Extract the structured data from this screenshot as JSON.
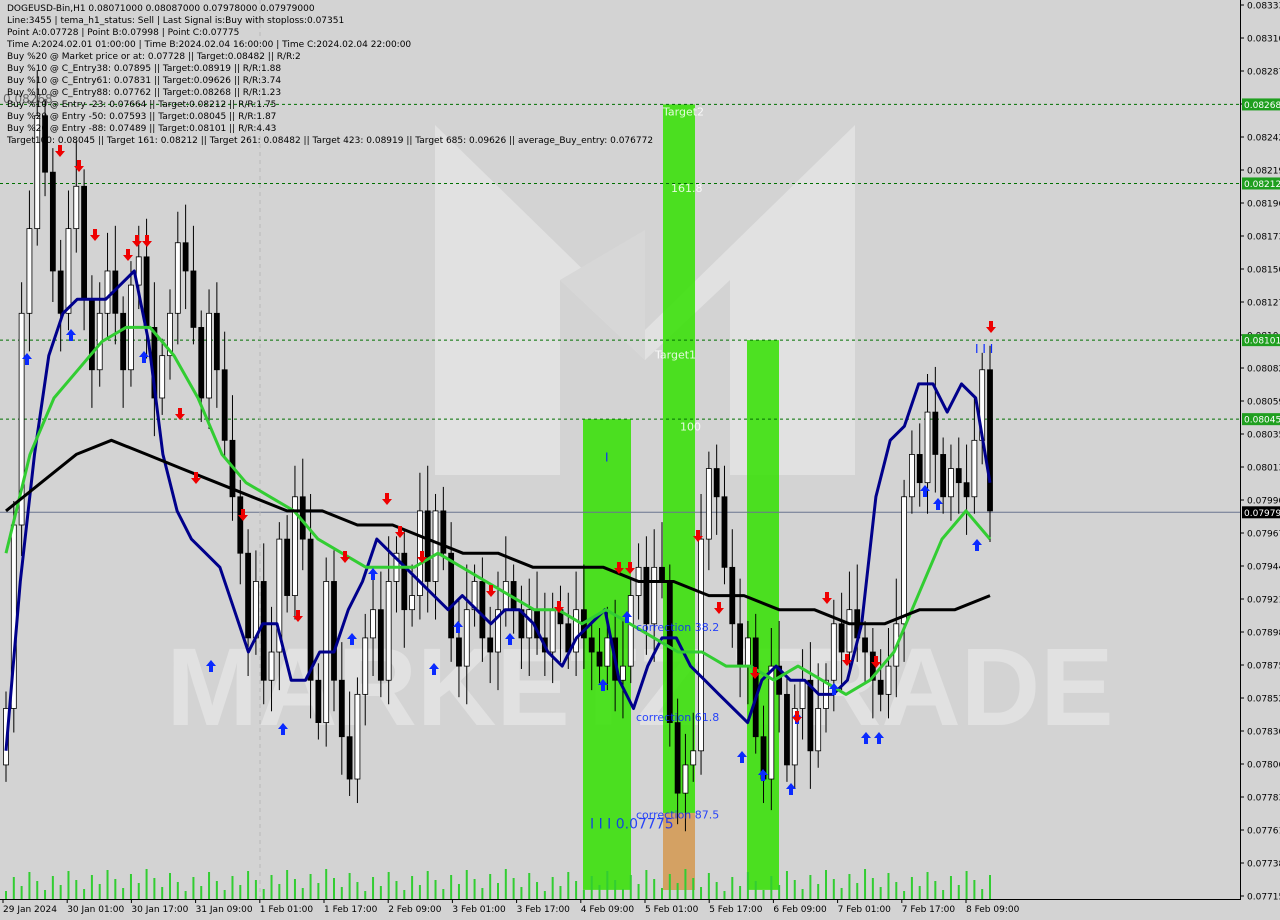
{
  "header": {
    "lines": [
      "DOGEUSD-Bin,H1  0.08071000 0.08087000 0.07978000 0.07979000",
      "Line:3455  |  tema_h1_status: Sell  |  Last Signal is:Buy with stoploss:0.07351",
      "Point A:0.07728  |  Point B:0.07998  |  Point C:0.07775",
      "Time A:2024.02.01 01:00:00  |  Time B:2024.02.04 16:00:00  |  Time C:2024.02.04 22:00:00",
      "Buy %20 @ Market price or at: 0.07728  ||  Target:0.08482  ||  R/R:2",
      "Buy %10 @ C_Entry38: 0.07895  ||  Target:0.08919  ||  R/R:1.88",
      "Buy %10 @ C_Entry61: 0.07831  ||  Target:0.09626  ||  R/R:3.74",
      "Buy %10 @ C_Entry88: 0.07762  ||  Target:0.08268  ||  R/R:1.23",
      "Buy %10 @ Entry -23: 0.07664  ||  Target:0.08212  ||  R/R:1.75",
      "Buy %20 @ Entry -50: 0.07593  ||  Target:0.08045  ||  R/R:1.87",
      "Buy %20 @ Entry -88: 0.07489  ||  Target:0.08101  ||  R/R:4.43",
      "Target100: 0.08045  ||  Target 161: 0.08212  ||  Target 261: 0.08482  ||  Target 423: 0.08919  ||  Target 685: 0.09626  ||  average_Buy_entry: 0.076772"
    ],
    "overlay_price": "0.08268"
  },
  "watermark": {
    "text": "MARKETZ TRADE"
  },
  "colors": {
    "background": "#d3d3d3",
    "bull_candle": "#ffffff",
    "bear_candle": "#000000",
    "fast_ma": "#00008b",
    "mid_ma": "#32cd32",
    "slow_ma": "#000000",
    "target_green": "#32e100",
    "fib_orange": "#e39a6a",
    "buy_arrow": "#0a2aff",
    "sell_arrow": "#ee0000",
    "level_line": "#007000",
    "price_tag": "#000000"
  },
  "zones": [
    {
      "label": "Target2",
      "x_from": "5 Feb 01:00",
      "x_to": "5 Feb 09:00",
      "y_top": 0.08268,
      "y_bottom": 0.07715,
      "color": "#32e100"
    },
    {
      "label": "Target1",
      "x_from": "6 Feb 01:00",
      "x_to": "6 Feb 09:00",
      "y_top": 0.08101,
      "y_bottom": 0.07715,
      "color": "#32e100"
    },
    {
      "label": "100",
      "x_from": "4 Feb 09:00",
      "x_to": "4 Feb 17:00",
      "y_top": 0.08045,
      "y_bottom": 0.07715,
      "color": "#32e100"
    },
    {
      "label": "correction 87.5",
      "x_from": "5 Feb 01:00",
      "x_to": "5 Feb 09:00",
      "y_top": 0.07766,
      "y_bottom": 0.07715,
      "color": "#e39a6a"
    }
  ],
  "zone_labels": [
    {
      "text": "Target2",
      "price": 0.0826
    },
    {
      "text": "161.8",
      "price": 0.08206
    },
    {
      "text": "Target1",
      "price": 0.08088
    },
    {
      "text": "100",
      "price": 0.08037
    },
    {
      "text": "correction 38.2",
      "price": 0.07895
    },
    {
      "text": "correction 61.8",
      "price": 0.07831
    },
    {
      "text": "correction 87.5",
      "price": 0.07762
    },
    {
      "text": "I I I 0.07775",
      "price": 0.07755
    }
  ],
  "markers": [
    {
      "text": "I",
      "price": 0.08015
    },
    {
      "text": "I  I  I",
      "price": 0.08092
    }
  ],
  "levels": [
    {
      "price": 0.08268,
      "label": "0.08268"
    },
    {
      "price": 0.08212,
      "label": "0.08212"
    },
    {
      "price": 0.08101,
      "label": "0.08101"
    },
    {
      "price": 0.08045,
      "label": "0.08045"
    }
  ],
  "current_price": {
    "value": 0.07979,
    "label": "0.07979"
  },
  "chart_data": {
    "type": "candlestick",
    "symbol": "DOGEUSD-Bin",
    "timeframe": "H1",
    "ohlc_last": {
      "open": 0.08071,
      "high": 0.08087,
      "low": 0.07978,
      "close": 0.07979
    },
    "ylim": [
      0.07705,
      0.08342
    ],
    "y_ticks": [
      "0.08333",
      "0.08310",
      "0.08287",
      "0.08264",
      "0.08242",
      "0.08219",
      "0.08196",
      "0.08173",
      "0.08150",
      "0.08127",
      "0.08104",
      "0.08082",
      "0.08059",
      "0.08035",
      "0.08013",
      "0.07990",
      "0.07967",
      "0.07944",
      "0.07921",
      "0.07898",
      "0.07875",
      "0.07852",
      "0.07830",
      "0.07806",
      "0.07783",
      "0.07761",
      "0.07738",
      "0.07715"
    ],
    "x_ticks": [
      "29 Jan 2024",
      "30 Jan 01:00",
      "30 Jan 17:00",
      "31 Jan 09:00",
      "1 Feb 01:00",
      "1 Feb 17:00",
      "2 Feb 09:00",
      "3 Feb 01:00",
      "3 Feb 17:00",
      "4 Feb 09:00",
      "5 Feb 01:00",
      "5 Feb 17:00",
      "6 Feb 09:00",
      "7 Feb 01:00",
      "7 Feb 17:00",
      "8 Feb 09:00"
    ],
    "candles_close": [
      0.0784,
      0.0797,
      0.0812,
      0.0818,
      0.0826,
      0.0822,
      0.0815,
      0.0812,
      0.0818,
      0.0821,
      0.0813,
      0.0808,
      0.0812,
      0.0815,
      0.0812,
      0.0808,
      0.0814,
      0.0816,
      0.0811,
      0.0806,
      0.0809,
      0.0812,
      0.0817,
      0.0815,
      0.0811,
      0.0806,
      0.0812,
      0.0808,
      0.0803,
      0.0799,
      0.0795,
      0.0789,
      0.0793,
      0.0786,
      0.0788,
      0.0796,
      0.0792,
      0.0799,
      0.0796,
      0.0786,
      0.0783,
      0.0793,
      0.0786,
      0.0782,
      0.0779,
      0.0785,
      0.0789,
      0.0791,
      0.0786,
      0.0793,
      0.0795,
      0.0791,
      0.0792,
      0.0798,
      0.0793,
      0.0798,
      0.0795,
      0.0789,
      0.0787,
      0.0791,
      0.0793,
      0.0789,
      0.0788,
      0.0791,
      0.0793,
      0.0791,
      0.0789,
      0.0791,
      0.0789,
      0.0788,
      0.0791,
      0.079,
      0.0788,
      0.0791,
      0.0789,
      0.0788,
      0.0787,
      0.0789,
      0.0786,
      0.0787,
      0.0792,
      0.0794,
      0.079,
      0.0794,
      0.0793,
      0.0783,
      0.0778,
      0.078,
      0.0781,
      0.0796,
      0.0801,
      0.0799,
      0.0794,
      0.079,
      0.0787,
      0.0789,
      0.0782,
      0.0779,
      0.0787,
      0.0785,
      0.078,
      0.0784,
      0.0786,
      0.0781,
      0.0784,
      0.0786,
      0.079,
      0.0788,
      0.0791,
      0.0789,
      0.0788,
      0.0786,
      0.0785,
      0.0787,
      0.079,
      0.0799,
      0.0802,
      0.08,
      0.0805,
      0.0802,
      0.0799,
      0.0801,
      0.08,
      0.0799,
      0.0803,
      0.0808,
      0.0798
    ],
    "series": [
      {
        "name": "",
        "color": "#00008b",
        "values": [
          0.0781,
          0.0793,
          0.0802,
          0.0809,
          0.0812,
          0.0813,
          0.0813,
          0.0813,
          0.0814,
          0.0815,
          0.081,
          0.0802,
          0.0798,
          0.0796,
          0.0795,
          0.0794,
          0.0791,
          0.0788,
          0.079,
          0.079,
          0.0786,
          0.0786,
          0.0788,
          0.0788,
          0.0791,
          0.0793,
          0.0796,
          0.0795,
          0.0794,
          0.0793,
          0.0792,
          0.0791,
          0.0792,
          0.0791,
          0.079,
          0.0791,
          0.0791,
          0.079,
          0.0788,
          0.0787,
          0.0789,
          0.079,
          0.0791,
          0.0786,
          0.0784,
          0.0787,
          0.0789,
          0.0789,
          0.0787,
          0.0786,
          0.0785,
          0.0784,
          0.0783,
          0.0786,
          0.0787,
          0.0786,
          0.0786,
          0.0785,
          0.0785,
          0.0786,
          0.079,
          0.0799,
          0.0803,
          0.0804,
          0.0807,
          0.0807,
          0.0805,
          0.0807,
          0.0806,
          0.08
        ]
      },
      {
        "name": "",
        "color": "#32cd32",
        "values": [
          0.0795,
          0.0802,
          0.0806,
          0.0808,
          0.081,
          0.0811,
          0.0811,
          0.0809,
          0.0806,
          0.0802,
          0.08,
          0.0799,
          0.0798,
          0.0796,
          0.0795,
          0.0794,
          0.0794,
          0.0794,
          0.0795,
          0.0794,
          0.0793,
          0.0792,
          0.0791,
          0.0791,
          0.079,
          0.0791,
          0.079,
          0.0789,
          0.0788,
          0.0788,
          0.0787,
          0.0787,
          0.0786,
          0.0787,
          0.0786,
          0.0785,
          0.0786,
          0.0788,
          0.0792,
          0.0796,
          0.0798,
          0.0796
        ]
      },
      {
        "name": "",
        "color": "#000000",
        "values": [
          0.0798,
          0.08,
          0.0802,
          0.0803,
          0.0802,
          0.0801,
          0.08,
          0.0799,
          0.0798,
          0.0798,
          0.0797,
          0.0797,
          0.0796,
          0.0795,
          0.0795,
          0.0794,
          0.0794,
          0.0794,
          0.0793,
          0.0793,
          0.0792,
          0.0792,
          0.0791,
          0.0791,
          0.079,
          0.079,
          0.0791,
          0.0791,
          0.0792
        ]
      }
    ]
  }
}
